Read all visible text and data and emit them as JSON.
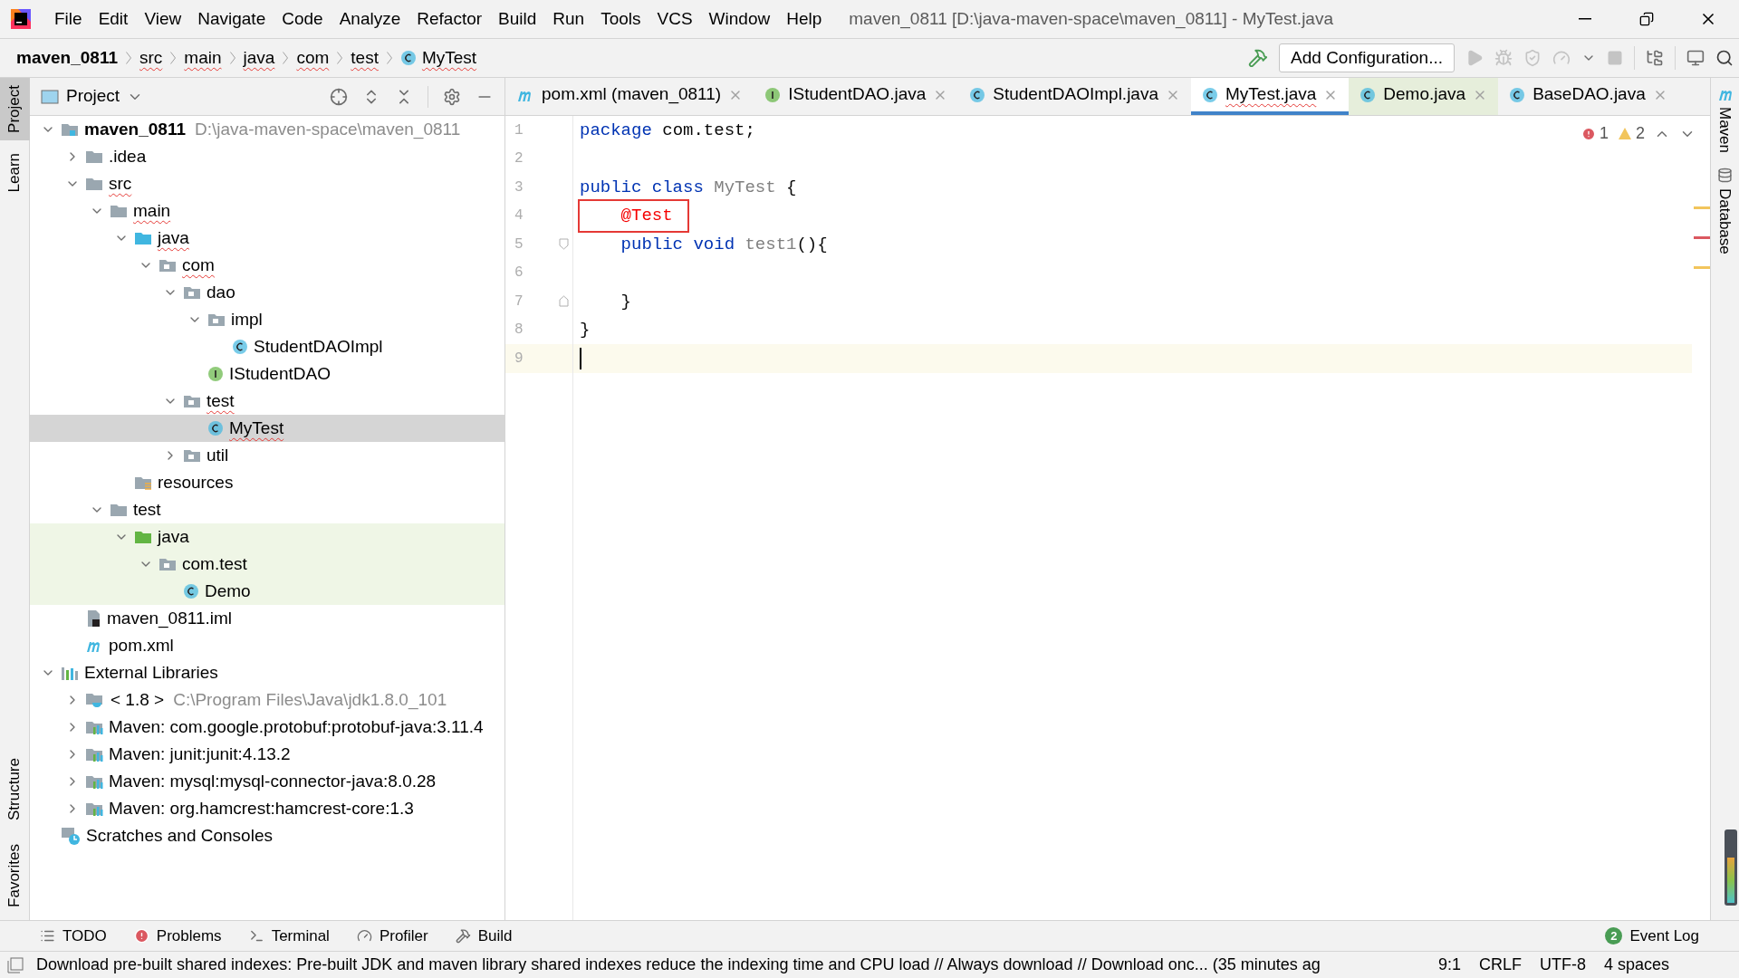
{
  "window": {
    "title": "maven_0811 [D:\\java-maven-space\\maven_0811] - MyTest.java"
  },
  "menu": [
    "File",
    "Edit",
    "View",
    "Navigate",
    "Code",
    "Analyze",
    "Refactor",
    "Build",
    "Run",
    "Tools",
    "VCS",
    "Window",
    "Help"
  ],
  "breadcrumbs": [
    {
      "label": "maven_0811",
      "kind": "project",
      "squiggle": false
    },
    {
      "label": "src",
      "kind": "folder",
      "squiggle": true
    },
    {
      "label": "main",
      "kind": "folder",
      "squiggle": true
    },
    {
      "label": "java",
      "kind": "folder",
      "squiggle": true
    },
    {
      "label": "com",
      "kind": "folder",
      "squiggle": true
    },
    {
      "label": "test",
      "kind": "folder",
      "squiggle": true
    },
    {
      "label": "MyTest",
      "kind": "class",
      "squiggle": true
    }
  ],
  "toolbar": {
    "run_config": "Add Configuration..."
  },
  "left_strip": [
    {
      "label": "Project",
      "selected": true
    },
    {
      "label": "Learn",
      "selected": false
    },
    {
      "label": "Structure",
      "selected": false
    },
    {
      "label": "Favorites",
      "selected": false
    }
  ],
  "right_strip": [
    {
      "label": "Maven",
      "kind": "maven"
    },
    {
      "label": "Database",
      "kind": "database"
    }
  ],
  "project_panel": {
    "title": "Project",
    "tree": [
      {
        "label": "maven_0811",
        "hint": "D:\\java-maven-space\\maven_0811",
        "kind": "module",
        "expanded": true,
        "selected": false,
        "highlighted": false,
        "squiggle": false,
        "children": [
          {
            "label": ".idea",
            "kind": "folder",
            "expanded": false,
            "selected": false,
            "highlighted": false,
            "squiggle": false
          },
          {
            "label": "src",
            "kind": "folder",
            "expanded": true,
            "selected": false,
            "highlighted": false,
            "squiggle": true,
            "children": [
              {
                "label": "main",
                "kind": "folder",
                "expanded": true,
                "selected": false,
                "highlighted": false,
                "squiggle": true,
                "children": [
                  {
                    "label": "java",
                    "kind": "source",
                    "expanded": true,
                    "selected": false,
                    "highlighted": false,
                    "squiggle": true,
                    "children": [
                      {
                        "label": "com",
                        "kind": "package",
                        "expanded": true,
                        "selected": false,
                        "highlighted": false,
                        "squiggle": true,
                        "children": [
                          {
                            "label": "dao",
                            "kind": "package",
                            "expanded": true,
                            "selected": false,
                            "highlighted": false,
                            "squiggle": false,
                            "children": [
                              {
                                "label": "impl",
                                "kind": "package",
                                "expanded": true,
                                "selected": false,
                                "highlighted": false,
                                "squiggle": false,
                                "children": [
                                  {
                                    "label": "StudentDAOImpl",
                                    "kind": "class",
                                    "selected": false,
                                    "highlighted": false,
                                    "squiggle": false
                                  }
                                ]
                              },
                              {
                                "label": "IStudentDAO",
                                "kind": "interface",
                                "selected": false,
                                "highlighted": false,
                                "squiggle": false
                              }
                            ]
                          },
                          {
                            "label": "test",
                            "kind": "package",
                            "expanded": true,
                            "selected": false,
                            "highlighted": false,
                            "squiggle": true,
                            "children": [
                              {
                                "label": "MyTest",
                                "kind": "class",
                                "selected": true,
                                "highlighted": false,
                                "squiggle": true
                              }
                            ]
                          },
                          {
                            "label": "util",
                            "kind": "package",
                            "expanded": false,
                            "selected": false,
                            "highlighted": false,
                            "squiggle": false
                          }
                        ]
                      }
                    ]
                  },
                  {
                    "label": "resources",
                    "kind": "resources",
                    "selected": false,
                    "highlighted": false,
                    "squiggle": false
                  }
                ]
              },
              {
                "label": "test",
                "kind": "folder",
                "expanded": true,
                "selected": false,
                "highlighted": false,
                "squiggle": false,
                "children": [
                  {
                    "label": "java",
                    "kind": "test-source",
                    "expanded": true,
                    "selected": false,
                    "highlighted": true,
                    "squiggle": false,
                    "children": [
                      {
                        "label": "com.test",
                        "kind": "package",
                        "expanded": true,
                        "selected": false,
                        "highlighted": true,
                        "squiggle": false,
                        "children": [
                          {
                            "label": "Demo",
                            "kind": "class",
                            "selected": false,
                            "highlighted": true,
                            "squiggle": false
                          }
                        ]
                      }
                    ]
                  }
                ]
              }
            ]
          },
          {
            "label": "maven_0811.iml",
            "kind": "iml",
            "selected": false,
            "highlighted": false,
            "squiggle": false
          },
          {
            "label": "pom.xml",
            "kind": "maven-file",
            "selected": false,
            "highlighted": false,
            "squiggle": false
          }
        ]
      },
      {
        "label": "External Libraries",
        "kind": "libraries",
        "expanded": true,
        "selected": false,
        "highlighted": false,
        "squiggle": false,
        "children": [
          {
            "label": "< 1.8 >",
            "hint": "C:\\Program Files\\Java\\jdk1.8.0_101",
            "kind": "jdk",
            "expanded": false,
            "selected": false,
            "highlighted": false,
            "squiggle": false
          },
          {
            "label": "Maven: com.google.protobuf:protobuf-java:3.11.4",
            "kind": "library",
            "expanded": false,
            "selected": false,
            "highlighted": false,
            "squiggle": false
          },
          {
            "label": "Maven: junit:junit:4.13.2",
            "kind": "library",
            "expanded": false,
            "selected": false,
            "highlighted": false,
            "squiggle": false
          },
          {
            "label": "Maven: mysql:mysql-connector-java:8.0.28",
            "kind": "library",
            "expanded": false,
            "selected": false,
            "highlighted": false,
            "squiggle": false
          },
          {
            "label": "Maven: org.hamcrest:hamcrest-core:1.3",
            "kind": "library",
            "expanded": false,
            "selected": false,
            "highlighted": false,
            "squiggle": false
          }
        ]
      },
      {
        "label": "Scratches and Consoles",
        "kind": "scratches",
        "selected": false,
        "highlighted": false,
        "squiggle": false
      }
    ]
  },
  "editor_tabs": [
    {
      "label": "pom.xml (maven_0811)",
      "kind": "maven-file",
      "selected": false,
      "highlighted": false,
      "squiggle": false
    },
    {
      "label": "IStudentDAO.java",
      "kind": "interface",
      "selected": false,
      "highlighted": false,
      "squiggle": false
    },
    {
      "label": "StudentDAOImpl.java",
      "kind": "class",
      "selected": false,
      "highlighted": false,
      "squiggle": false
    },
    {
      "label": "MyTest.java",
      "kind": "class",
      "selected": true,
      "highlighted": false,
      "squiggle": true
    },
    {
      "label": "Demo.java",
      "kind": "class",
      "selected": false,
      "highlighted": true,
      "squiggle": false
    },
    {
      "label": "BaseDAO.java",
      "kind": "class",
      "selected": false,
      "highlighted": false,
      "squiggle": false
    }
  ],
  "inspections": {
    "errors": "1",
    "warnings": "2"
  },
  "stripe_marks": [
    {
      "kind": "warning"
    },
    {
      "kind": "error"
    },
    {
      "kind": "warning"
    }
  ],
  "code": [
    {
      "number": "1",
      "current": false,
      "tokens": [
        {
          "text": "package",
          "kind": "keyword"
        },
        {
          "text": " com.test;",
          "kind": "plain"
        }
      ]
    },
    {
      "number": "2",
      "current": false
    },
    {
      "number": "3",
      "current": false,
      "tokens": [
        {
          "text": "public class",
          "kind": "keyword"
        },
        {
          "text": " MyTest",
          "kind": "unused"
        },
        {
          "text": " {",
          "kind": "plain"
        }
      ]
    },
    {
      "number": "4",
      "current": false,
      "tokens": [
        {
          "text": "    @Test",
          "kind": "error",
          "boxed": true
        }
      ]
    },
    {
      "number": "5",
      "current": false,
      "fold_start": true,
      "tokens": [
        {
          "text": "    public void",
          "kind": "keyword"
        },
        {
          "text": " test1",
          "kind": "unused"
        },
        {
          "text": "(){",
          "kind": "plain"
        }
      ]
    },
    {
      "number": "6",
      "current": false
    },
    {
      "number": "7",
      "current": false,
      "fold_end": true,
      "tokens": [
        {
          "text": "    }",
          "kind": "plain"
        }
      ]
    },
    {
      "number": "8",
      "current": false,
      "tokens": [
        {
          "text": "}",
          "kind": "plain"
        }
      ]
    },
    {
      "number": "9",
      "current": true
    }
  ],
  "bottom_tools": [
    {
      "label": "TODO",
      "kind": "todo"
    },
    {
      "label": "Problems",
      "kind": "problems"
    },
    {
      "label": "Terminal",
      "kind": "terminal"
    },
    {
      "label": "Profiler",
      "kind": "profiler"
    },
    {
      "label": "Build",
      "kind": "build"
    }
  ],
  "event_log": {
    "label": "Event Log",
    "count": "2"
  },
  "status_bar": {
    "message": "Download pre-built shared indexes: Pre-built JDK and maven library shared indexes reduce the indexing time and CPU load // Always download // Download onc... (35 minutes ag",
    "position": "9:1",
    "line_separator": "CRLF",
    "encoding": "UTF-8",
    "indent": "4 spaces"
  }
}
